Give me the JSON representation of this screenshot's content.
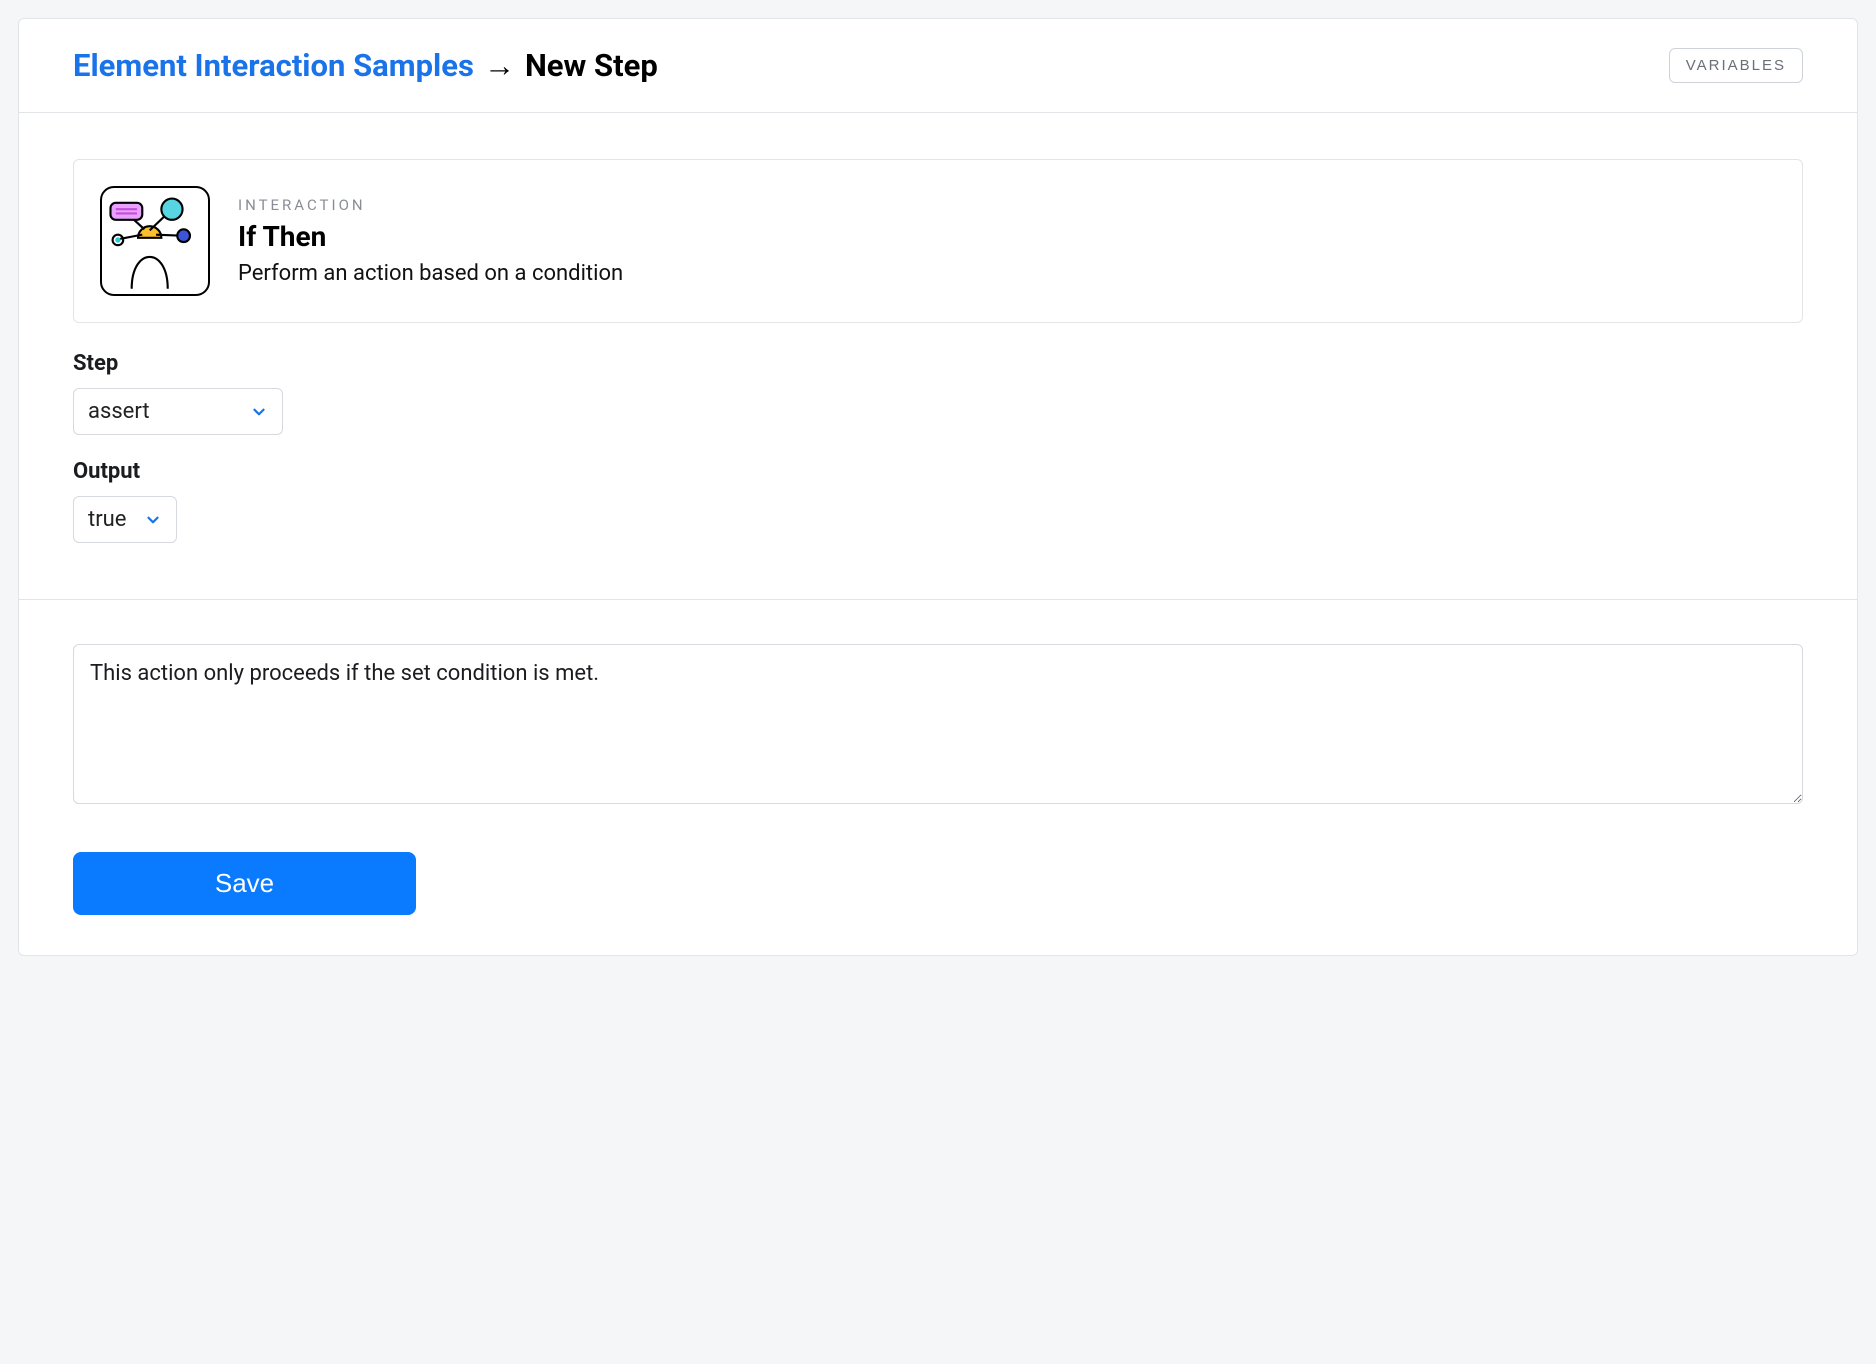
{
  "header": {
    "breadcrumb_link": "Element Interaction Samples",
    "breadcrumb_arrow": "→",
    "breadcrumb_current": "New Step",
    "variables_btn": "VARIABLES"
  },
  "card": {
    "label": "INTERACTION",
    "title": "If Then",
    "description": "Perform an action based on a condition"
  },
  "form": {
    "step_label": "Step",
    "step_value": "assert",
    "output_label": "Output",
    "output_value": "true"
  },
  "footer": {
    "note_value": "This action only proceeds if the set condition is met.",
    "save_label": "Save"
  }
}
